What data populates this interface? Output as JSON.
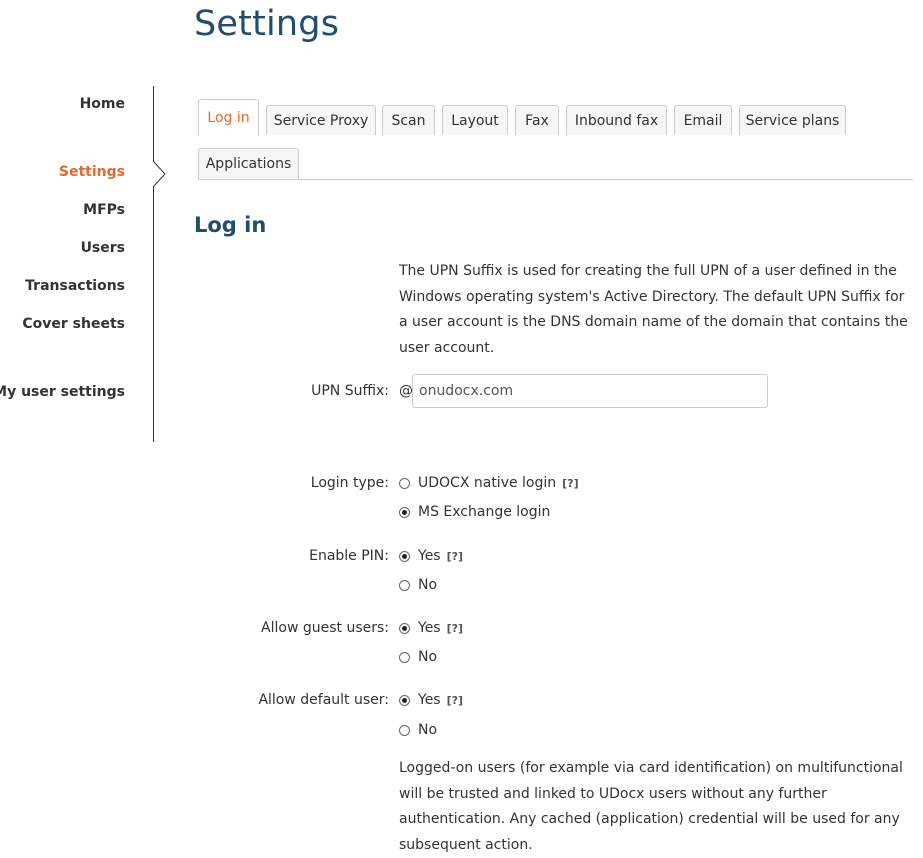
{
  "page": {
    "title": "Settings"
  },
  "sidebar": {
    "items": [
      {
        "label": "Home"
      },
      {
        "label": "Settings"
      },
      {
        "label": "MFPs"
      },
      {
        "label": "Users"
      },
      {
        "label": "Transactions"
      },
      {
        "label": "Cover sheets"
      },
      {
        "label": "My user settings"
      }
    ],
    "active": "Settings",
    "accent_color": "#e8692c"
  },
  "tabs": [
    {
      "label": "Log in"
    },
    {
      "label": "Service Proxy"
    },
    {
      "label": "Scan"
    },
    {
      "label": "Layout"
    },
    {
      "label": "Fax"
    },
    {
      "label": "Inbound fax"
    },
    {
      "label": "Email"
    },
    {
      "label": "Service plans"
    },
    {
      "label": "Applications"
    }
  ],
  "section": {
    "title": "Log in",
    "upn_description": "The UPN Suffix is used for creating the full UPN of a user defined in the Windows operating system's Active Directory. The default UPN Suffix for a user account is the DNS domain name of the domain that contains the user account.",
    "upn_label": "UPN Suffix:",
    "upn_prefix": "@",
    "upn_value": "onudocx.com",
    "login_type": {
      "label": "Login type:",
      "options": [
        {
          "label": "UDOCX native login",
          "checked": false,
          "help": "[?]"
        },
        {
          "label": "MS Exchange login",
          "checked": true
        }
      ]
    },
    "enable_pin": {
      "label": "Enable PIN:",
      "options": [
        {
          "label": "Yes",
          "checked": true,
          "help": "[?]"
        },
        {
          "label": "No",
          "checked": false
        }
      ]
    },
    "allow_guest": {
      "label": "Allow guest users:",
      "options": [
        {
          "label": "Yes",
          "checked": true,
          "help": "[?]"
        },
        {
          "label": "No",
          "checked": false
        }
      ]
    },
    "allow_default": {
      "label": "Allow default user:",
      "options": [
        {
          "label": "Yes",
          "checked": true,
          "help": "[?]"
        },
        {
          "label": "No",
          "checked": false
        }
      ]
    },
    "default_user_description": "Logged-on users (for example via card identification) on multifunctional will be trusted and linked to UDocx users without any further authentication. Any cached (application) credential will be used for any subsequent action."
  },
  "colors": {
    "title": "#1f4e6e",
    "accent": "#e8692c"
  }
}
